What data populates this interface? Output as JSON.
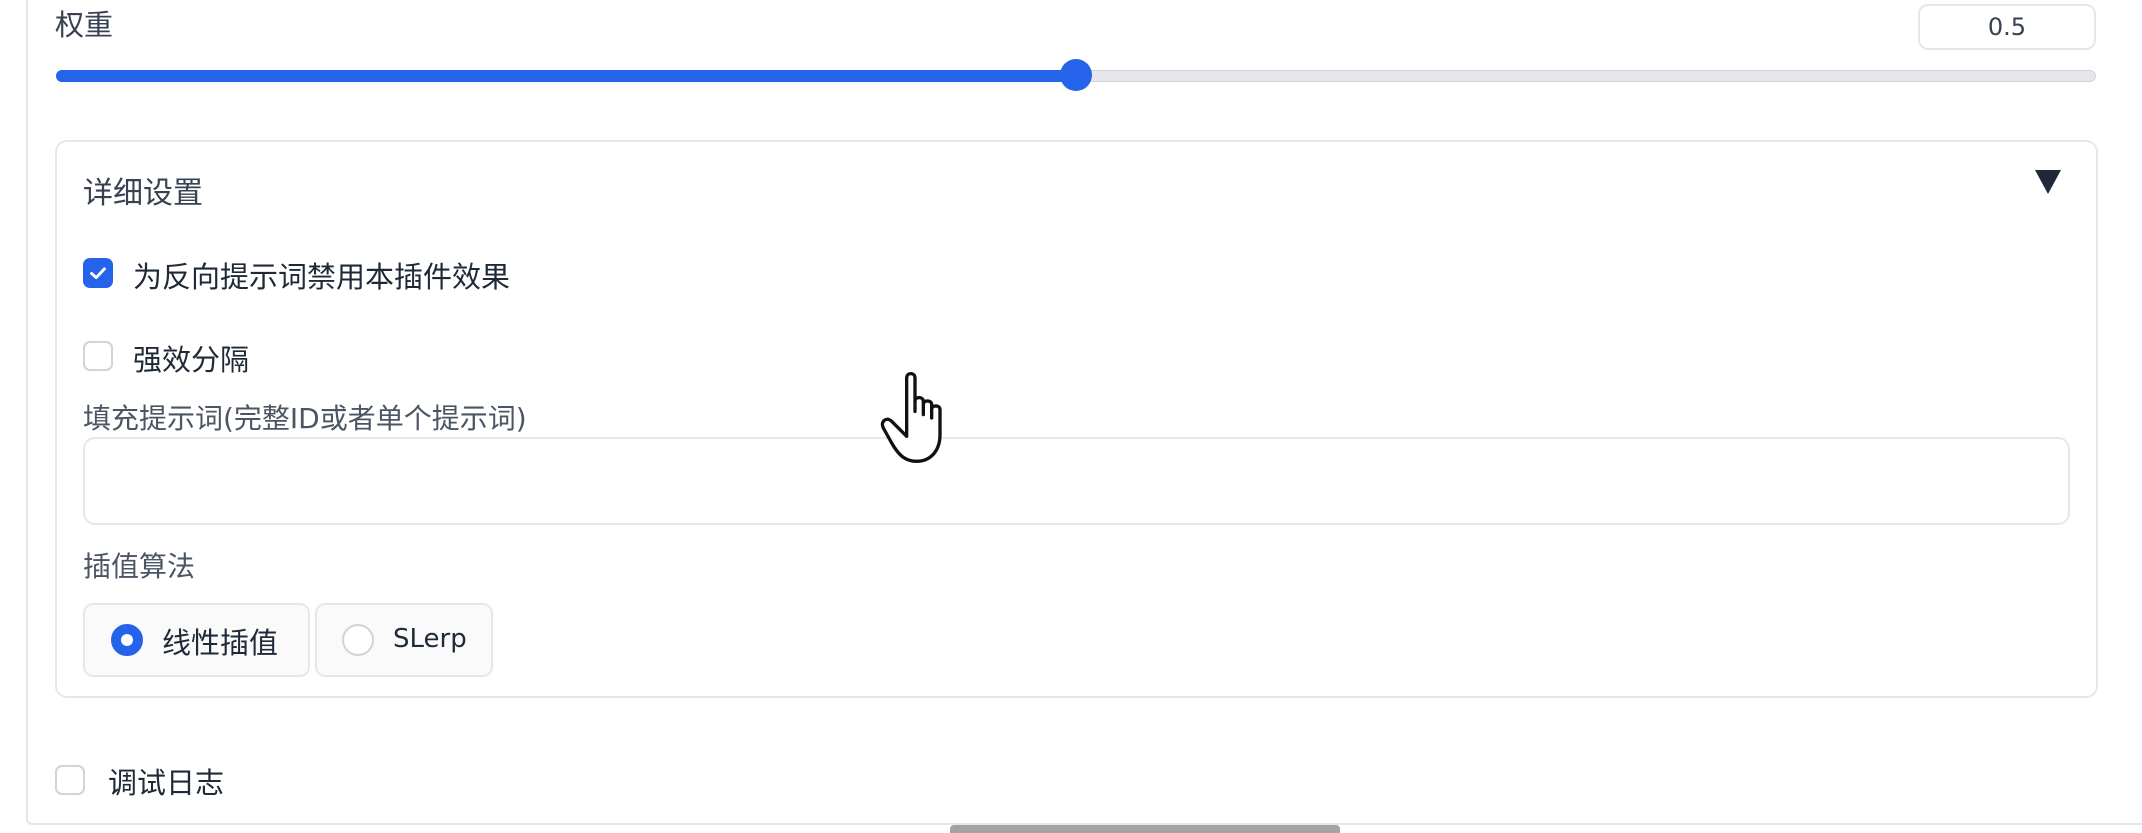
{
  "weight": {
    "label": "权重",
    "value": "0.5",
    "slider_fraction": 0.5
  },
  "details": {
    "title": "详细设置",
    "disable_negative": {
      "label": "为反向提示词禁用本插件效果",
      "checked": true
    },
    "strong_separator": {
      "label": "强效分隔",
      "checked": false
    },
    "fill_prompt": {
      "label": "填充提示词(完整ID或者单个提示词)",
      "value": ""
    },
    "interpolation": {
      "label": "插值算法",
      "options": [
        {
          "label": "线性插值",
          "selected": true
        },
        {
          "label": "SLerp",
          "selected": false
        }
      ]
    }
  },
  "debug_log": {
    "label": "调试日志",
    "checked": false
  },
  "colors": {
    "accent": "#2563eb",
    "border": "#e5e7eb"
  }
}
